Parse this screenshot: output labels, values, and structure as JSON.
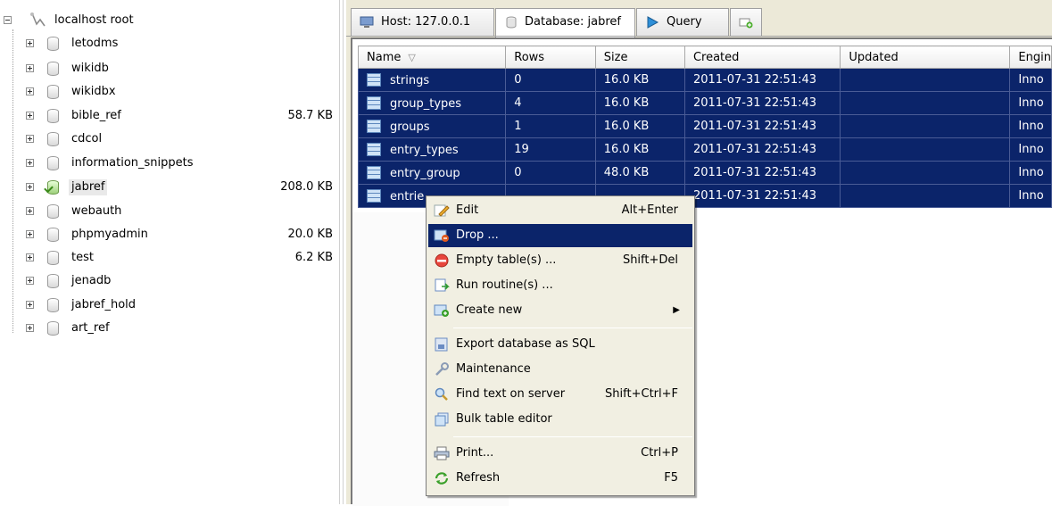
{
  "tree": {
    "root_label": "localhost root",
    "databases": [
      {
        "name": "letodms",
        "size": ""
      },
      {
        "name": "wikidb",
        "size": ""
      },
      {
        "name": "wikidbx",
        "size": ""
      },
      {
        "name": "bible_ref",
        "size": "58.7 KB"
      },
      {
        "name": "cdcol",
        "size": ""
      },
      {
        "name": "information_snippets",
        "size": ""
      },
      {
        "name": "jabref",
        "size": "208.0 KB"
      },
      {
        "name": "webauth",
        "size": ""
      },
      {
        "name": "phpmyadmin",
        "size": "20.0 KB"
      },
      {
        "name": "test",
        "size": "6.2 KB"
      },
      {
        "name": "jenadb",
        "size": ""
      },
      {
        "name": "jabref_hold",
        "size": ""
      },
      {
        "name": "art_ref",
        "size": ""
      }
    ],
    "selected_index": 6
  },
  "tabs": [
    {
      "label": "Host: 127.0.0.1",
      "icon": "host-icon"
    },
    {
      "label": "Database: jabref",
      "icon": "database-icon"
    },
    {
      "label": "Query",
      "icon": "query-icon"
    },
    {
      "label": "",
      "icon": "new-query-tab-icon"
    }
  ],
  "grid": {
    "headers": [
      "Name",
      "Rows",
      "Size",
      "Created",
      "Updated",
      "Engin"
    ],
    "rows": [
      [
        "strings",
        "0",
        "16.0 KB",
        "2011-07-31 22:51:43",
        "",
        "Inno"
      ],
      [
        "group_types",
        "4",
        "16.0 KB",
        "2011-07-31 22:51:43",
        "",
        "Inno"
      ],
      [
        "groups",
        "1",
        "16.0 KB",
        "2011-07-31 22:51:43",
        "",
        "Inno"
      ],
      [
        "entry_types",
        "19",
        "16.0 KB",
        "2011-07-31 22:51:43",
        "",
        "Inno"
      ],
      [
        "entry_group",
        "0",
        "48.0 KB",
        "2011-07-31 22:51:43",
        "",
        "Inno"
      ],
      [
        "entrie",
        "",
        "",
        "2011-07-31 22:51:43",
        "",
        "Inno"
      ]
    ]
  },
  "context_menu": {
    "items": [
      {
        "label": "Edit",
        "shortcut": "Alt+Enter",
        "icon": "edit-icon"
      },
      {
        "label": "Drop ...",
        "shortcut": "",
        "icon": "drop-icon",
        "highlighted": true
      },
      {
        "label": "Empty table(s) ...",
        "shortcut": "Shift+Del",
        "icon": "empty-table-icon"
      },
      {
        "label": "Run routine(s) ...",
        "shortcut": "",
        "icon": "run-routine-icon"
      },
      {
        "label": "Create new",
        "shortcut": "",
        "icon": "create-new-icon",
        "submenu": true
      },
      {
        "label": "Export database as SQL",
        "shortcut": "",
        "icon": "export-icon"
      },
      {
        "label": "Maintenance",
        "shortcut": "",
        "icon": "maintenance-icon"
      },
      {
        "label": "Find text on server",
        "shortcut": "Shift+Ctrl+F",
        "icon": "find-icon"
      },
      {
        "label": "Bulk table editor",
        "shortcut": "",
        "icon": "bulk-editor-icon"
      },
      {
        "label": "Print...",
        "shortcut": "Ctrl+P",
        "icon": "print-icon"
      },
      {
        "label": "Refresh",
        "shortcut": "F5",
        "icon": "refresh-icon"
      }
    ]
  },
  "colors": {
    "selection": "#0b246a",
    "panel": "#ece9d8",
    "menu_bg": "#f1efe2"
  }
}
